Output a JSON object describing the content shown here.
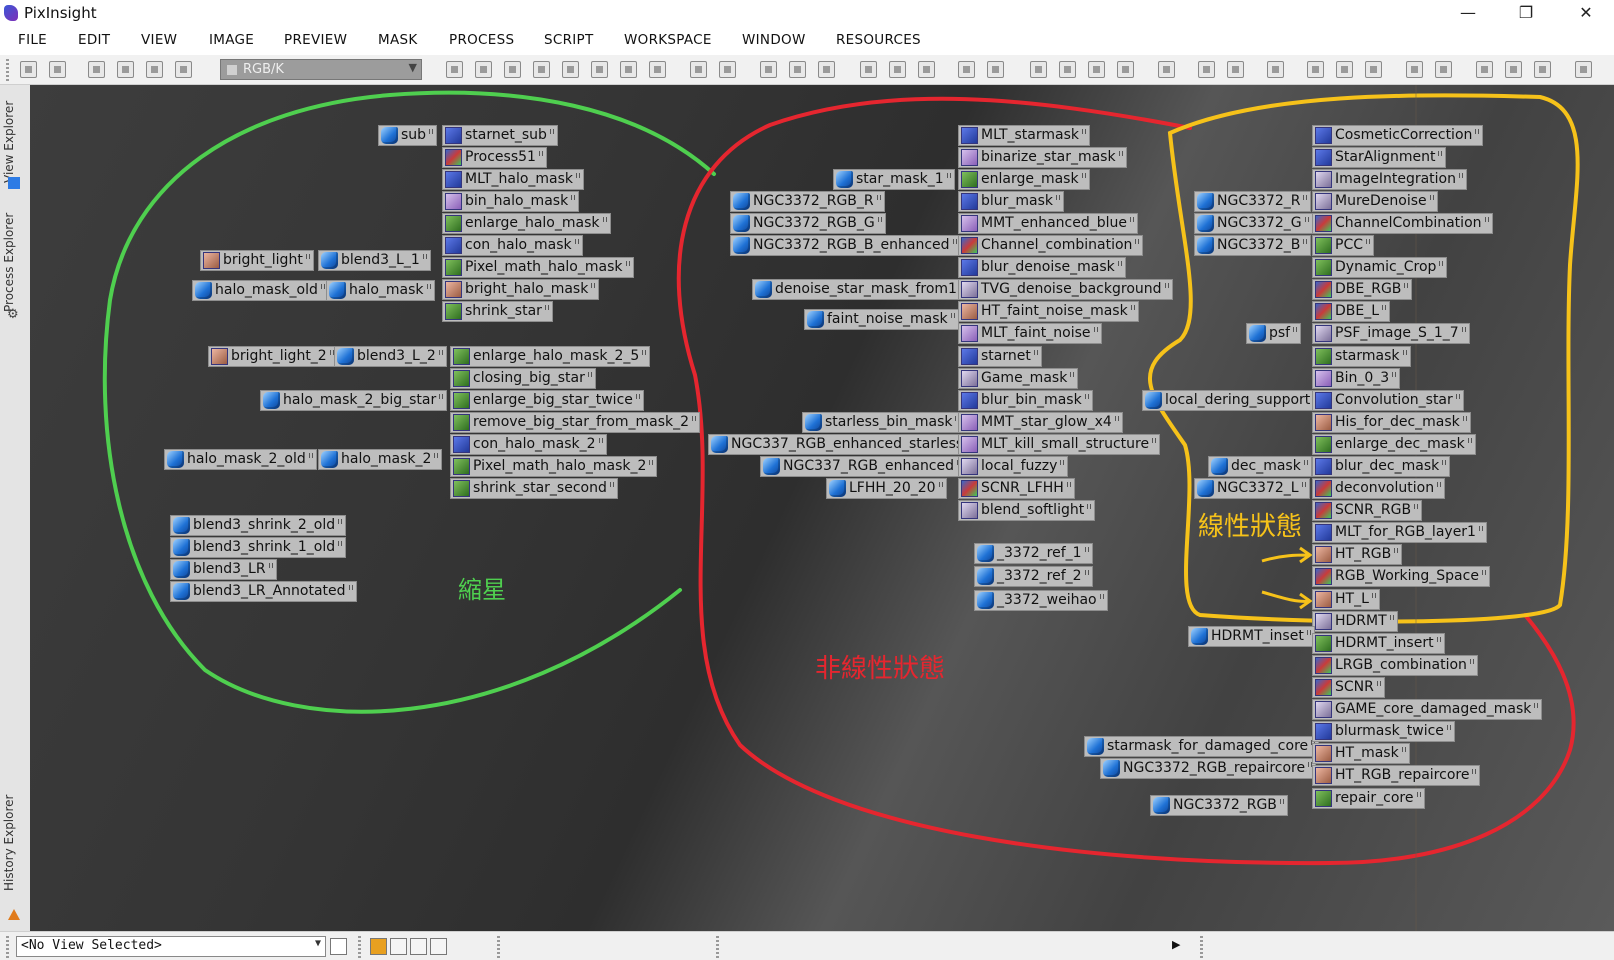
{
  "app": {
    "title": "PixInsight"
  },
  "window_controls": {
    "minimize": "—",
    "maximize": "❐",
    "close": "✕"
  },
  "menu": [
    "FILE",
    "EDIT",
    "VIEW",
    "IMAGE",
    "PREVIEW",
    "MASK",
    "PROCESS",
    "SCRIPT",
    "WORKSPACE",
    "WINDOW",
    "RESOURCES"
  ],
  "toolbar": {
    "color_space": "RGB/K"
  },
  "sidebar": {
    "view_explorer": "View Explorer",
    "process_explorer": "Process Explorer",
    "history_explorer": "History Explorer"
  },
  "annotations": {
    "green_label": "縮星",
    "red_label": "非線性狀態",
    "yellow_label": "線性狀態",
    "colors": {
      "green": "#4fcf4f",
      "red": "#e5262f",
      "yellow": "#f6c21a"
    }
  },
  "icons": [
    {
      "label": "sub",
      "kind": "img"
    },
    {
      "label": "starnet_sub",
      "kind": "proc",
      "t": "t1"
    },
    {
      "label": "Process51",
      "kind": "proc",
      "t": "t6"
    },
    {
      "label": "MLT_halo_mask",
      "kind": "proc",
      "t": "t1"
    },
    {
      "label": "bin_halo_mask",
      "kind": "proc",
      "t": "t2"
    },
    {
      "label": "enlarge_halo_mask",
      "kind": "proc",
      "t": "t5"
    },
    {
      "label": "con_halo_mask",
      "kind": "proc",
      "t": "t1"
    },
    {
      "label": "bright_light",
      "kind": "proc",
      "t": "t3"
    },
    {
      "label": "blend3_L_1",
      "kind": "img"
    },
    {
      "label": "Pixel_math_halo_mask",
      "kind": "proc",
      "t": "t5"
    },
    {
      "label": "halo_mask_old",
      "kind": "img"
    },
    {
      "label": "halo_mask",
      "kind": "img"
    },
    {
      "label": "bright_halo_mask",
      "kind": "proc",
      "t": "t3"
    },
    {
      "label": "shrink_star",
      "kind": "proc",
      "t": "t5"
    },
    {
      "label": "bright_light_2",
      "kind": "proc",
      "t": "t3"
    },
    {
      "label": "blend3_L_2",
      "kind": "img"
    },
    {
      "label": "enlarge_halo_mask_2_5",
      "kind": "proc",
      "t": "t5"
    },
    {
      "label": "closing_big_star",
      "kind": "proc",
      "t": "t5"
    },
    {
      "label": "halo_mask_2_big_star",
      "kind": "img"
    },
    {
      "label": "enlarge_big_star_twice",
      "kind": "proc",
      "t": "t5"
    },
    {
      "label": "remove_big_star_from_mask_2",
      "kind": "proc",
      "t": "t5"
    },
    {
      "label": "con_halo_mask_2",
      "kind": "proc",
      "t": "t1"
    },
    {
      "label": "halo_mask_2_old",
      "kind": "img"
    },
    {
      "label": "halo_mask_2",
      "kind": "img"
    },
    {
      "label": "Pixel_math_halo_mask_2",
      "kind": "proc",
      "t": "t5"
    },
    {
      "label": "shrink_star_second",
      "kind": "proc",
      "t": "t5"
    },
    {
      "label": "blend3_shrink_2_old",
      "kind": "img"
    },
    {
      "label": "blend3_shrink_1_old",
      "kind": "img"
    },
    {
      "label": "blend3_LR",
      "kind": "img"
    },
    {
      "label": "blend3_LR_Annotated",
      "kind": "img"
    },
    {
      "label": "MLT_starmask",
      "kind": "proc",
      "t": "t1"
    },
    {
      "label": "binarize_star_mask",
      "kind": "proc",
      "t": "t2"
    },
    {
      "label": "star_mask_1",
      "kind": "img"
    },
    {
      "label": "enlarge_mask",
      "kind": "proc",
      "t": "t5"
    },
    {
      "label": "NGC3372_RGB_R",
      "kind": "img"
    },
    {
      "label": "blur_mask",
      "kind": "proc",
      "t": "t1"
    },
    {
      "label": "NGC3372_RGB_G",
      "kind": "img"
    },
    {
      "label": "MMT_enhanced_blue",
      "kind": "proc",
      "t": "t2"
    },
    {
      "label": "NGC3372_RGB_B_enhanced",
      "kind": "img"
    },
    {
      "label": "Channel_combination",
      "kind": "proc",
      "t": "t6"
    },
    {
      "label": "blur_denoise_mask",
      "kind": "proc",
      "t": "t1"
    },
    {
      "label": "denoise_star_mask_from1",
      "kind": "img"
    },
    {
      "label": "TVG_denoise_background",
      "kind": "proc",
      "t": "t4"
    },
    {
      "label": "HT_faint_noise_mask",
      "kind": "proc",
      "t": "t3"
    },
    {
      "label": "faint_noise_mask",
      "kind": "img"
    },
    {
      "label": "MLT_faint_noise",
      "kind": "proc",
      "t": "t2"
    },
    {
      "label": "starnet",
      "kind": "proc",
      "t": "t1"
    },
    {
      "label": "Game_mask",
      "kind": "proc",
      "t": "t4"
    },
    {
      "label": "blur_bin_mask",
      "kind": "proc",
      "t": "t1"
    },
    {
      "label": "starless_bin_mask",
      "kind": "img"
    },
    {
      "label": "MMT_star_glow_x4",
      "kind": "proc",
      "t": "t2"
    },
    {
      "label": "NGC337_RGB_enhanced_starless",
      "kind": "img"
    },
    {
      "label": "MLT_kill_small_structure",
      "kind": "proc",
      "t": "t2"
    },
    {
      "label": "NGC337_RGB_enhanced",
      "kind": "img"
    },
    {
      "label": "local_fuzzy",
      "kind": "proc",
      "t": "t4"
    },
    {
      "label": "LFHH_20_20",
      "kind": "img"
    },
    {
      "label": "SCNR_LFHH",
      "kind": "proc",
      "t": "t6"
    },
    {
      "label": "blend_softlight",
      "kind": "proc",
      "t": "t4"
    },
    {
      "label": "_3372_ref_1",
      "kind": "img"
    },
    {
      "label": "_3372_ref_2",
      "kind": "img"
    },
    {
      "label": "_3372_weihao",
      "kind": "img"
    },
    {
      "label": "CosmeticCorrection",
      "kind": "proc",
      "t": "t1"
    },
    {
      "label": "StarAlignment",
      "kind": "proc",
      "t": "t1"
    },
    {
      "label": "ImageIntegration",
      "kind": "proc",
      "t": "t4"
    },
    {
      "label": "NGC3372_R",
      "kind": "img"
    },
    {
      "label": "MureDenoise",
      "kind": "proc",
      "t": "t4"
    },
    {
      "label": "NGC3372_G",
      "kind": "img"
    },
    {
      "label": "ChannelCombination",
      "kind": "proc",
      "t": "t6"
    },
    {
      "label": "NGC3372_B",
      "kind": "img"
    },
    {
      "label": "PCC",
      "kind": "proc",
      "t": "t5"
    },
    {
      "label": "Dynamic_Crop",
      "kind": "proc",
      "t": "t5"
    },
    {
      "label": "DBE_RGB",
      "kind": "proc",
      "t": "t6"
    },
    {
      "label": "DBE_L",
      "kind": "proc",
      "t": "t6"
    },
    {
      "label": "psf",
      "kind": "img"
    },
    {
      "label": "PSF_image_S_1_7",
      "kind": "proc",
      "t": "t4"
    },
    {
      "label": "starmask",
      "kind": "proc",
      "t": "t5"
    },
    {
      "label": "Bin_0_3",
      "kind": "proc",
      "t": "t2"
    },
    {
      "label": "local_dering_support",
      "kind": "img"
    },
    {
      "label": "Convolution_star",
      "kind": "proc",
      "t": "t1"
    },
    {
      "label": "His_for_dec_mask",
      "kind": "proc",
      "t": "t3"
    },
    {
      "label": "enlarge_dec_mask",
      "kind": "proc",
      "t": "t5"
    },
    {
      "label": "dec_mask",
      "kind": "img"
    },
    {
      "label": "blur_dec_mask",
      "kind": "proc",
      "t": "t1"
    },
    {
      "label": "NGC3372_L",
      "kind": "img"
    },
    {
      "label": "deconvolution",
      "kind": "proc",
      "t": "t6"
    },
    {
      "label": "SCNR_RGB",
      "kind": "proc",
      "t": "t6"
    },
    {
      "label": "MLT_for_RGB_layer1",
      "kind": "proc",
      "t": "t1"
    },
    {
      "label": "HT_RGB",
      "kind": "proc",
      "t": "t3"
    },
    {
      "label": "RGB_Working_Space",
      "kind": "proc",
      "t": "t6"
    },
    {
      "label": "HT_L",
      "kind": "proc",
      "t": "t3"
    },
    {
      "label": "HDRMT",
      "kind": "proc",
      "t": "t4"
    },
    {
      "label": "HDRMT_inset",
      "kind": "img"
    },
    {
      "label": "HDRMT_insert",
      "kind": "proc",
      "t": "t5"
    },
    {
      "label": "LRGB_combination",
      "kind": "proc",
      "t": "t6"
    },
    {
      "label": "SCNR",
      "kind": "proc",
      "t": "t6"
    },
    {
      "label": "GAME_core_damaged_mask",
      "kind": "proc",
      "t": "t4"
    },
    {
      "label": "starmask_for_damaged_core",
      "kind": "img"
    },
    {
      "label": "blurmask_twice",
      "kind": "proc",
      "t": "t1"
    },
    {
      "label": "NGC3372_RGB_repaircore",
      "kind": "img"
    },
    {
      "label": "HT_mask",
      "kind": "proc",
      "t": "t3"
    },
    {
      "label": "HT_RGB_repaircore",
      "kind": "proc",
      "t": "t3"
    },
    {
      "label": "NGC3372_RGB",
      "kind": "img"
    },
    {
      "label": "repair_core",
      "kind": "proc",
      "t": "t5"
    }
  ],
  "statusbar": {
    "view_select": "<No View Selected>",
    "play": "▶"
  }
}
